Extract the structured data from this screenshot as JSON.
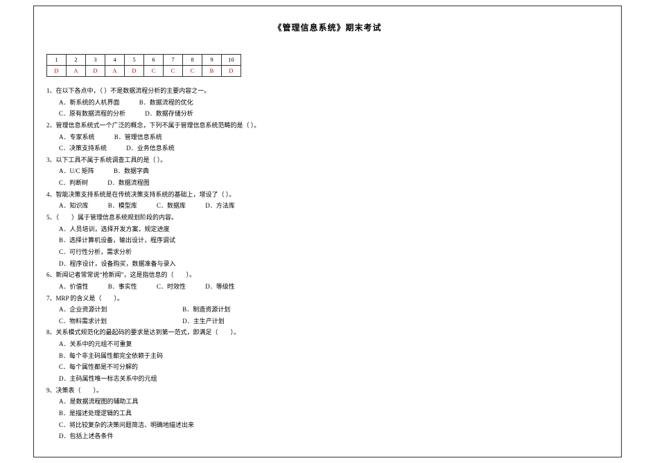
{
  "title": "《管理信息系统》期末考试",
  "answer_header": [
    "1",
    "2",
    "3",
    "4",
    "5",
    "6",
    "7",
    "8",
    "9",
    "10"
  ],
  "answer_values": [
    "D",
    "A",
    "D",
    "A",
    "D",
    "C",
    "C",
    "C",
    "B",
    "D"
  ],
  "q1": {
    "stem": "1、在以下各点中，（    ）不是数据流程分析的主要内容之一。",
    "a": "A．新系统的人机界面",
    "b": "B．数据流程的优化",
    "c": "C．原有数据流程的分析",
    "d": "D．数据存储分析"
  },
  "q2": {
    "stem": "2、管理信息系统式一个广泛的概念，下列不属于管理信息系统范畴的是（    ）。",
    "a": "A．专家系统",
    "b": "B．管理信息系统",
    "c": "C．决策支持系统",
    "d": "D．业务信息系统"
  },
  "q3": {
    "stem": "3、以下工具不属于系统调查工具的是（    ）。",
    "a": "A．U/C 矩阵",
    "b": "B．数据字典",
    "c": "C．判断树",
    "d": "D．数据流程图"
  },
  "q4": {
    "stem": "4、智能决策支持系统是在传统决策支持系统的基础上，增设了（    ）。",
    "a": "A．知识库",
    "b": "B．模型库",
    "c": "C．数据库",
    "d": "D．方法库"
  },
  "q5": {
    "stem": "5、（　　）属于管理信息系统规划阶段的内容。",
    "a": "A．人员培训，选择开发方案，规定进度",
    "b": "B．选择计算机设备，输出设计，程序调试",
    "c": "C．可行性分析，需求分析",
    "d": "D．程序设计，设备购买，数据准备与录入"
  },
  "q6": {
    "stem": "6、新闻记者常常说“抢新闻”，这是指信息的（　　）。",
    "a": "A．价值性",
    "b": "B．事实性",
    "c": "C．时效性",
    "d": "D．等级性"
  },
  "q7": {
    "stem": "7、MRP 的含义是（　　）。",
    "a": "A．企业资源计划",
    "b": "B．制造资源计划",
    "c": "C．物料需求计划",
    "d": "D．主生产计划"
  },
  "q8": {
    "stem": "8、关系模式规范化的最起码的要求是达到第一范式，即满足（　　）。",
    "a": "A．关系中的元组不可重复",
    "b": "B．每个非主码属性都完全依赖于主码",
    "c": "C．每个属性都是不可分解的",
    "d": "D．主码属性唯一标志关系中的元组"
  },
  "q9": {
    "stem": "9、决策表（　　）。",
    "a": "A．是数据流程图的辅助工具",
    "b": "B．是描述处理逻辑的工具",
    "c": "C．将比较复杂的决策问题简洁、明确地描述出来",
    "d": "D．包括上述各条件"
  }
}
